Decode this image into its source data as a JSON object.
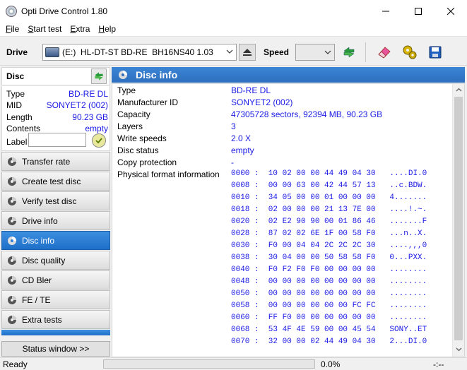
{
  "window": {
    "title": "Opti Drive Control 1.80"
  },
  "menu": [
    {
      "label": "File",
      "key": "F",
      "rest": "ile"
    },
    {
      "label": "Start test",
      "key": "S",
      "rest": "tart test"
    },
    {
      "label": "Extra",
      "key": "E",
      "rest": "xtra"
    },
    {
      "label": "Help",
      "key": "H",
      "rest": "elp"
    }
  ],
  "toolbar": {
    "drive_label": "Drive",
    "drive_value": "(E:)  HL-DT-ST BD-RE  BH16NS40 1.03",
    "speed_label": "Speed",
    "speed_value": ""
  },
  "disc": {
    "title": "Disc",
    "props": [
      {
        "key": "Type",
        "value": "BD-RE DL"
      },
      {
        "key": "MID",
        "value": "SONYET2 (002)"
      },
      {
        "key": "Length",
        "value": "90.23 GB"
      },
      {
        "key": "Contents",
        "value": "empty"
      }
    ],
    "label_key": "Label",
    "label_value": ""
  },
  "nav": [
    {
      "label": "Transfer rate",
      "active": false
    },
    {
      "label": "Create test disc",
      "active": false
    },
    {
      "label": "Verify test disc",
      "active": false
    },
    {
      "label": "Drive info",
      "active": false
    },
    {
      "label": "Disc info",
      "active": true
    },
    {
      "label": "Disc quality",
      "active": false
    },
    {
      "label": "CD Bler",
      "active": false
    },
    {
      "label": "FE / TE",
      "active": false
    },
    {
      "label": "Extra tests",
      "active": false
    }
  ],
  "status_window_button": "Status window >>",
  "main": {
    "title": "Disc info",
    "info": [
      {
        "key": "Type",
        "value": "BD-RE DL"
      },
      {
        "key": "Manufacturer ID",
        "value": "SONYET2 (002)"
      },
      {
        "key": "Capacity",
        "value": "47305728 sectors, 92394 MB, 90.23 GB"
      },
      {
        "key": "Layers",
        "value": "3"
      },
      {
        "key": "Write speeds",
        "value": "2.0 X"
      },
      {
        "key": "Disc status",
        "value": "empty"
      },
      {
        "key": "Copy protection",
        "value": "-"
      },
      {
        "key": "Physical format information",
        "value": ""
      }
    ],
    "hex": [
      "0000 :  10 02 00 00 44 49 04 30   ....DI.0",
      "0008 :  00 00 63 00 42 44 57 13   ..c.BDW.",
      "0010 :  34 05 00 00 01 00 00 00   4.......",
      "0018 :  02 00 00 00 21 13 7E 00   ....!.~.",
      "0020 :  02 E2 90 90 00 01 86 46   .......F",
      "0028 :  87 02 02 6E 1F 00 58 F0   ...n..X.",
      "0030 :  F0 00 04 04 2C 2C 2C 30   ....,,,0",
      "0038 :  30 04 00 00 50 58 58 F0   0...PXX.",
      "0040 :  F0 F2 F0 F0 00 00 00 00   ........",
      "0048 :  00 00 00 00 00 00 00 00   ........",
      "0050 :  00 00 00 00 00 00 00 00   ........",
      "0058 :  00 00 00 00 00 00 FC FC   ........",
      "0060 :  FF F0 00 00 00 00 00 00   ........",
      "0068 :  53 4F 4E 59 00 00 45 54   SONY..ET",
      "0070 :  32 00 00 02 44 49 04 30   2...DI.0"
    ]
  },
  "status": {
    "text": "Ready",
    "progress_percent": 0.0,
    "progress_label": "0.0%",
    "time": "-:--"
  },
  "colors": {
    "value_blue": "#1a1ae6",
    "nav_active": "#2e7fd6",
    "progress_green": "#06b025"
  }
}
